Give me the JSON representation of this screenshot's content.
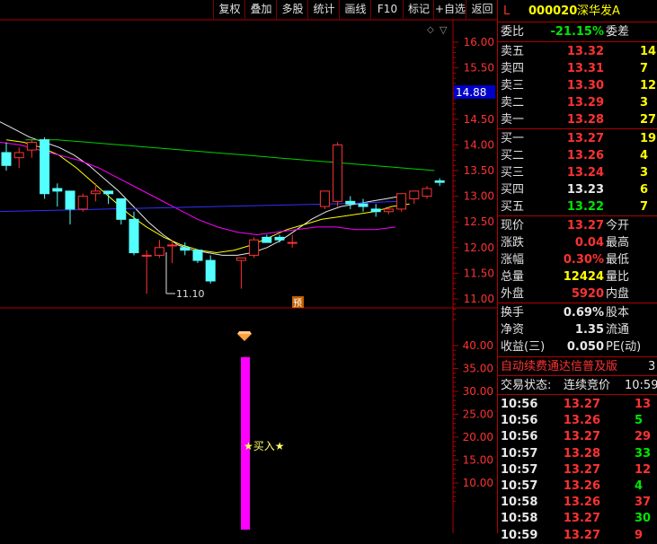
{
  "toolbar": {
    "buttons": [
      "复权",
      "叠加",
      "多股",
      "统计",
      "画线",
      "F10",
      "标记",
      "+自选",
      "返回"
    ]
  },
  "price_axis": {
    "ticks": [
      "16.00",
      "15.50",
      "15.00",
      "14.50",
      "14.00",
      "13.50",
      "13.00",
      "12.50",
      "12.00",
      "11.50",
      "11.00"
    ],
    "current_tag": "14.88"
  },
  "indicator_axis": {
    "ticks": [
      "40.00",
      "35.00",
      "30.00",
      "25.00",
      "20.00",
      "15.00",
      "10.00"
    ]
  },
  "chart_labels": {
    "low_label": "11.10",
    "pre_badge": "预",
    "buy_signal": "★买入★"
  },
  "chart_data": [
    {
      "type": "candlestick",
      "title": "",
      "ylim": [
        10.9,
        16.2
      ],
      "candles": [
        {
          "o": 13.85,
          "h": 14.05,
          "l": 13.5,
          "c": 13.6
        },
        {
          "o": 13.75,
          "h": 13.95,
          "l": 13.55,
          "c": 13.85
        },
        {
          "o": 13.9,
          "h": 14.1,
          "l": 13.75,
          "c": 14.05
        },
        {
          "o": 14.1,
          "h": 14.15,
          "l": 12.95,
          "c": 13.05
        },
        {
          "o": 13.15,
          "h": 13.25,
          "l": 12.8,
          "c": 13.1
        },
        {
          "o": 13.1,
          "h": 13.1,
          "l": 12.45,
          "c": 12.75
        },
        {
          "o": 12.75,
          "h": 13.05,
          "l": 12.7,
          "c": 13.0
        },
        {
          "o": 13.05,
          "h": 13.25,
          "l": 12.9,
          "c": 13.1
        },
        {
          "o": 13.1,
          "h": 13.1,
          "l": 12.85,
          "c": 13.05
        },
        {
          "o": 12.95,
          "h": 12.95,
          "l": 12.45,
          "c": 12.55
        },
        {
          "o": 12.55,
          "h": 12.7,
          "l": 11.85,
          "c": 11.9
        },
        {
          "o": 11.85,
          "h": 11.95,
          "l": 11.1,
          "c": 11.85
        },
        {
          "o": 11.85,
          "h": 12.15,
          "l": 11.8,
          "c": 12.0
        },
        {
          "o": 12.05,
          "h": 12.15,
          "l": 11.7,
          "c": 12.05
        },
        {
          "o": 12.0,
          "h": 12.1,
          "l": 11.85,
          "c": 11.95
        },
        {
          "o": 11.95,
          "h": 11.95,
          "l": 11.7,
          "c": 11.75
        },
        {
          "o": 11.75,
          "h": 11.85,
          "l": 11.3,
          "c": 11.35
        },
        {
          "o": 11.75,
          "h": 11.8,
          "l": 11.2,
          "c": 11.8
        },
        {
          "o": 11.85,
          "h": 12.2,
          "l": 11.8,
          "c": 12.15
        },
        {
          "o": 12.2,
          "h": 12.25,
          "l": 12.1,
          "c": 12.1
        },
        {
          "o": 12.2,
          "h": 12.25,
          "l": 12.1,
          "c": 12.15
        },
        {
          "o": 12.1,
          "h": 12.25,
          "l": 12.0,
          "c": 12.1
        },
        {
          "o": 12.8,
          "h": 13.05,
          "l": 12.75,
          "c": 13.1
        },
        {
          "o": 12.9,
          "h": 14.05,
          "l": 12.8,
          "c": 14.0
        },
        {
          "o": 12.9,
          "h": 13.0,
          "l": 12.75,
          "c": 12.85
        },
        {
          "o": 12.85,
          "h": 12.95,
          "l": 12.7,
          "c": 12.8
        },
        {
          "o": 12.75,
          "h": 12.85,
          "l": 12.6,
          "c": 12.7
        },
        {
          "o": 12.7,
          "h": 12.8,
          "l": 12.65,
          "c": 12.75
        },
        {
          "o": 12.75,
          "h": 13.05,
          "l": 12.7,
          "c": 13.05
        },
        {
          "o": 12.95,
          "h": 13.1,
          "l": 12.85,
          "c": 13.1
        },
        {
          "o": 13.0,
          "h": 13.2,
          "l": 12.95,
          "c": 13.15
        },
        {
          "o": 13.3,
          "h": 13.35,
          "l": 13.2,
          "c": 13.27
        }
      ],
      "moving_averages": [
        {
          "color": "#e8e8e8",
          "values": [
            14.45,
            14.3,
            14.15,
            14.05,
            13.95,
            13.8,
            13.6,
            13.35,
            13.1,
            12.8,
            12.5,
            12.25,
            12.05,
            11.95,
            11.9,
            11.85,
            11.85,
            11.9,
            12.0,
            12.15,
            12.35,
            12.55,
            12.7,
            12.8,
            12.85,
            12.9,
            12.95,
            13.0
          ]
        },
        {
          "color": "#ffff00",
          "values": [
            14.1,
            14.05,
            13.95,
            13.8,
            13.55,
            13.25,
            12.95,
            12.65,
            12.4,
            12.2,
            12.05,
            11.95,
            11.9,
            11.95,
            12.05,
            12.2,
            12.35,
            12.45,
            12.55,
            12.6,
            12.65,
            12.7,
            12.8,
            12.85
          ]
        },
        {
          "color": "#ff00ff",
          "values": [
            14.05,
            14.0,
            13.9,
            13.8,
            13.7,
            13.55,
            13.35,
            13.15,
            12.95,
            12.75,
            12.55,
            12.4,
            12.3,
            12.25,
            12.3,
            12.35,
            12.4,
            12.4,
            12.35,
            12.35,
            12.4
          ]
        },
        {
          "color": "#00d000",
          "values": [
            14.1,
            14.1,
            14.05,
            14.0,
            13.95,
            13.9,
            13.85,
            13.8,
            13.75,
            13.7,
            13.65,
            13.6,
            13.55,
            13.5
          ]
        },
        {
          "color": "#3030ff",
          "values": [
            12.7,
            12.72,
            12.74,
            12.76,
            12.78,
            12.8,
            12.82,
            12.84,
            12.86,
            12.9
          ]
        }
      ]
    },
    {
      "type": "bar",
      "title": "",
      "ylim": [
        3,
        45
      ],
      "bars": [
        {
          "index": 17,
          "value": 37.5,
          "color": "#ff00ff"
        }
      ]
    }
  ],
  "quote_panel": {
    "stock_code": "000020",
    "stock_name": "深华发A",
    "market_flag": "L",
    "weibi_label": "委比",
    "weibi_value": "-21.15%",
    "weicha_label": "委差",
    "asks": [
      {
        "label": "卖五",
        "price": "13.32",
        "vol": "14"
      },
      {
        "label": "卖四",
        "price": "13.31",
        "vol": "7"
      },
      {
        "label": "卖三",
        "price": "13.30",
        "vol": "12"
      },
      {
        "label": "卖二",
        "price": "13.29",
        "vol": "3"
      },
      {
        "label": "卖一",
        "price": "13.28",
        "vol": "27"
      }
    ],
    "bids": [
      {
        "label": "买一",
        "price": "13.27",
        "vol": "19"
      },
      {
        "label": "买二",
        "price": "13.26",
        "vol": "4"
      },
      {
        "label": "买三",
        "price": "13.24",
        "vol": "3"
      },
      {
        "label": "买四",
        "price": "13.23",
        "vol": "6"
      },
      {
        "label": "买五",
        "price": "13.22",
        "vol": "7"
      }
    ],
    "stats": [
      {
        "label": "现价",
        "value": "13.27",
        "label2": "今开"
      },
      {
        "label": "涨跌",
        "value": "0.04",
        "label2": "最高"
      },
      {
        "label": "涨幅",
        "value": "0.30%",
        "label2": "最低"
      },
      {
        "label": "总量",
        "value": "12424",
        "label2": "量比"
      },
      {
        "label": "外盘",
        "value": "5920",
        "label2": "内盘"
      }
    ],
    "fundamentals": [
      {
        "label": "换手",
        "value": "0.69%",
        "label2": "股本"
      },
      {
        "label": "净资",
        "value": "1.35",
        "label2": "流通"
      },
      {
        "label": "收益(三)",
        "value": "0.050",
        "label2": "PE(动)"
      }
    ],
    "ad_text": "自动续费通达信普及版",
    "ad_num": "3",
    "status_label": "交易状态:",
    "status_value": "连续竞价",
    "status_time": "10:59",
    "ticks": [
      {
        "time": "10:56",
        "price": "13.27",
        "vol": "13"
      },
      {
        "time": "10:56",
        "price": "13.26",
        "vol": "5"
      },
      {
        "time": "10:56",
        "price": "13.27",
        "vol": "29"
      },
      {
        "time": "10:57",
        "price": "13.28",
        "vol": "33"
      },
      {
        "time": "10:57",
        "price": "13.27",
        "vol": "12"
      },
      {
        "time": "10:57",
        "price": "13.26",
        "vol": "4"
      },
      {
        "time": "10:58",
        "price": "13.26",
        "vol": "37"
      },
      {
        "time": "10:58",
        "price": "13.27",
        "vol": "30"
      },
      {
        "time": "10:59",
        "price": "13.27",
        "vol": "9"
      }
    ]
  }
}
